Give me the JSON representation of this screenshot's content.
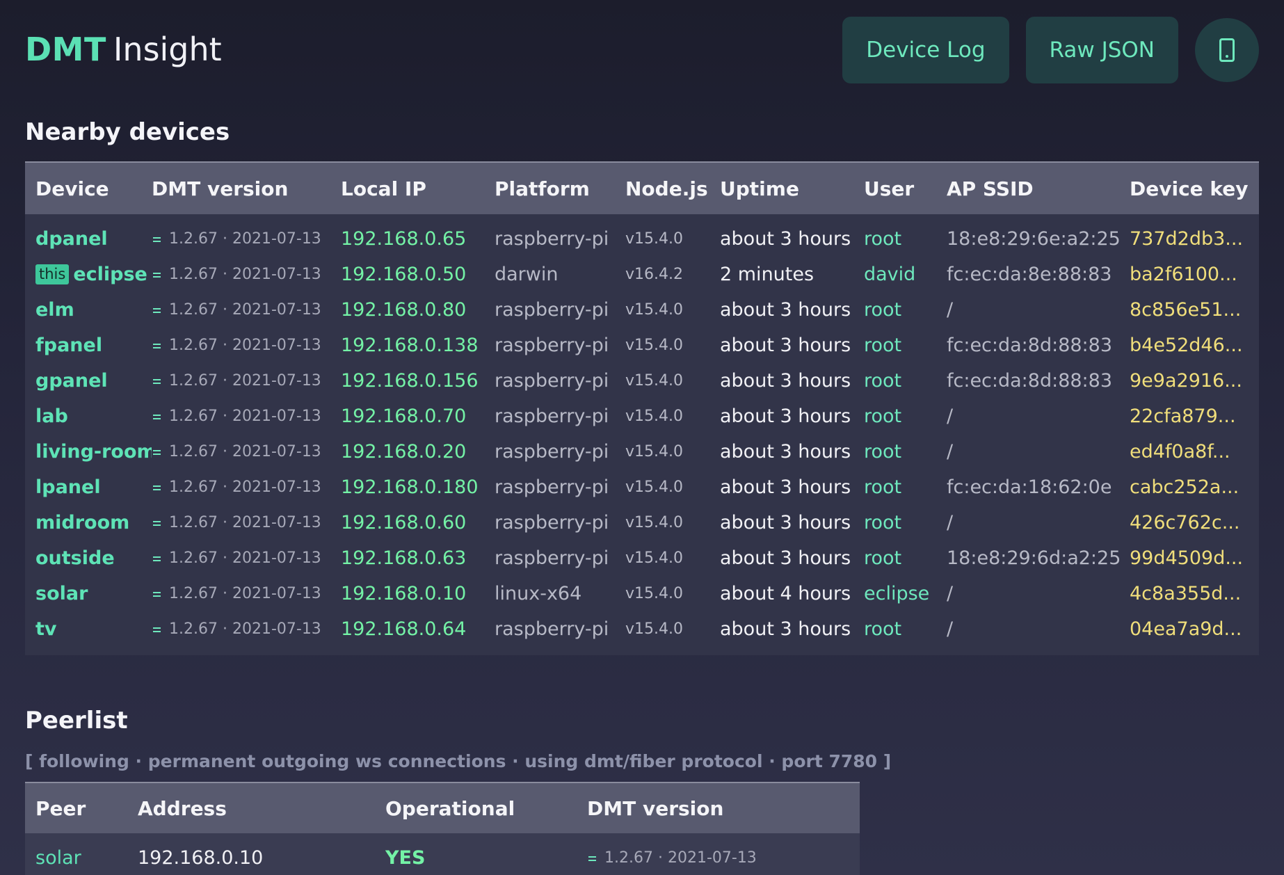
{
  "header": {
    "brand_primary": "DMT",
    "brand_secondary": "Insight",
    "device_log_label": "Device Log",
    "raw_json_label": "Raw JSON",
    "device_icon": "mobile-phone-icon"
  },
  "nearby": {
    "title": "Nearby devices",
    "columns": [
      "Device",
      "DMT version",
      "Local IP",
      "Platform",
      "Node.js",
      "Uptime",
      "User",
      "AP SSID",
      "Device key"
    ],
    "this_badge": "this",
    "rows": [
      {
        "device": "dpanel",
        "this": false,
        "version": "1.2.67 · 2021-07-13",
        "ip": "192.168.0.65",
        "platform": "raspberry-pi",
        "node": "v15.4.0",
        "uptime": "about 3 hours",
        "user": "root",
        "ssid": "18:e8:29:6e:a2:25",
        "key": "737d2db3..."
      },
      {
        "device": "eclipse",
        "this": true,
        "version": "1.2.67 · 2021-07-13",
        "ip": "192.168.0.50",
        "platform": "darwin",
        "node": "v16.4.2",
        "uptime": "2 minutes",
        "user": "david",
        "ssid": "fc:ec:da:8e:88:83",
        "key": "ba2f6100..."
      },
      {
        "device": "elm",
        "this": false,
        "version": "1.2.67 · 2021-07-13",
        "ip": "192.168.0.80",
        "platform": "raspberry-pi",
        "node": "v15.4.0",
        "uptime": "about 3 hours",
        "user": "root",
        "ssid": "/",
        "key": "8c856e51..."
      },
      {
        "device": "fpanel",
        "this": false,
        "version": "1.2.67 · 2021-07-13",
        "ip": "192.168.0.138",
        "platform": "raspberry-pi",
        "node": "v15.4.0",
        "uptime": "about 3 hours",
        "user": "root",
        "ssid": "fc:ec:da:8d:88:83",
        "key": "b4e52d46..."
      },
      {
        "device": "gpanel",
        "this": false,
        "version": "1.2.67 · 2021-07-13",
        "ip": "192.168.0.156",
        "platform": "raspberry-pi",
        "node": "v15.4.0",
        "uptime": "about 3 hours",
        "user": "root",
        "ssid": "fc:ec:da:8d:88:83",
        "key": "9e9a2916..."
      },
      {
        "device": "lab",
        "this": false,
        "version": "1.2.67 · 2021-07-13",
        "ip": "192.168.0.70",
        "platform": "raspberry-pi",
        "node": "v15.4.0",
        "uptime": "about 3 hours",
        "user": "root",
        "ssid": "/",
        "key": "22cfa879..."
      },
      {
        "device": "living-room",
        "this": false,
        "version": "1.2.67 · 2021-07-13",
        "ip": "192.168.0.20",
        "platform": "raspberry-pi",
        "node": "v15.4.0",
        "uptime": "about 3 hours",
        "user": "root",
        "ssid": "/",
        "key": "ed4f0a8f..."
      },
      {
        "device": "lpanel",
        "this": false,
        "version": "1.2.67 · 2021-07-13",
        "ip": "192.168.0.180",
        "platform": "raspberry-pi",
        "node": "v15.4.0",
        "uptime": "about 3 hours",
        "user": "root",
        "ssid": "fc:ec:da:18:62:0e",
        "key": "cabc252a..."
      },
      {
        "device": "midroom",
        "this": false,
        "version": "1.2.67 · 2021-07-13",
        "ip": "192.168.0.60",
        "platform": "raspberry-pi",
        "node": "v15.4.0",
        "uptime": "about 3 hours",
        "user": "root",
        "ssid": "/",
        "key": "426c762c..."
      },
      {
        "device": "outside",
        "this": false,
        "version": "1.2.67 · 2021-07-13",
        "ip": "192.168.0.63",
        "platform": "raspberry-pi",
        "node": "v15.4.0",
        "uptime": "about 3 hours",
        "user": "root",
        "ssid": "18:e8:29:6d:a2:25",
        "key": "99d4509d..."
      },
      {
        "device": "solar",
        "this": false,
        "version": "1.2.67 · 2021-07-13",
        "ip": "192.168.0.10",
        "platform": "linux-x64",
        "node": "v15.4.0",
        "uptime": "about 4 hours",
        "user": "eclipse",
        "ssid": "/",
        "key": "4c8a355d..."
      },
      {
        "device": "tv",
        "this": false,
        "version": "1.2.67 · 2021-07-13",
        "ip": "192.168.0.64",
        "platform": "raspberry-pi",
        "node": "v15.4.0",
        "uptime": "about 3 hours",
        "user": "root",
        "ssid": "/",
        "key": "04ea7a9d..."
      }
    ]
  },
  "peerlist": {
    "title": "Peerlist",
    "subtitle": "[ following · permanent outgoing ws connections · using dmt/fiber protocol · port 7780 ]",
    "columns": [
      "Peer",
      "Address",
      "Operational",
      "DMT version"
    ],
    "rows": [
      {
        "peer": "solar",
        "address": "192.168.0.10",
        "operational": "YES",
        "version": "1.2.67 · 2021-07-13"
      }
    ]
  },
  "colors": {
    "accent": "#5be0b4",
    "ip": "#74f2a6",
    "device_key": "#f0de7b",
    "button_bg": "#213e43"
  }
}
